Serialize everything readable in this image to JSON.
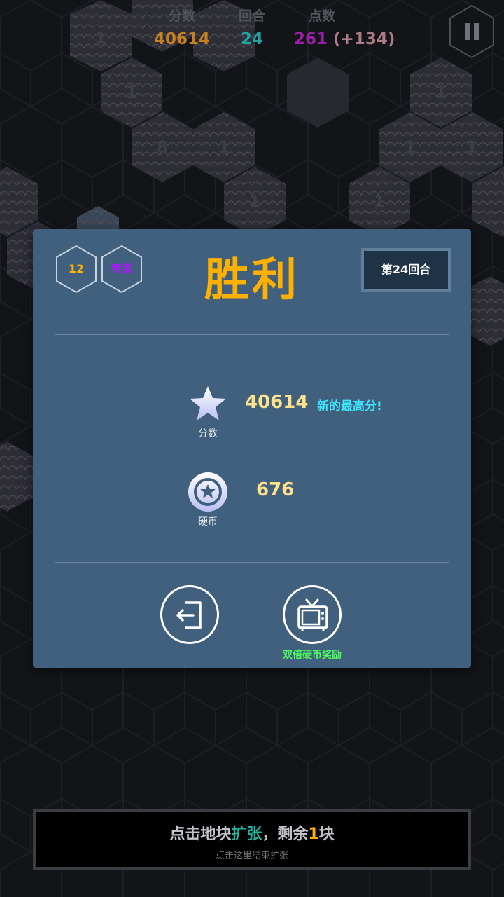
{
  "hud": {
    "score_label": "分数",
    "score_value": "40614",
    "round_label": "回合",
    "round_value": "24",
    "points_label": "点数",
    "points_value": "261",
    "points_bonus": "(+134)",
    "pause_icon": "pause-icon"
  },
  "board": {
    "tile_numbers": [
      "1",
      "1",
      "8",
      "1",
      "1",
      "1",
      "1",
      "1",
      "1"
    ]
  },
  "dialog": {
    "level_badge": "12",
    "difficulty_badge": "专家",
    "title": "胜利",
    "round_badge": "第24回合",
    "score_caption": "分数",
    "score_value": "40614",
    "new_best": "新的最高分!",
    "coins_caption": "硬币",
    "coins_value": "676",
    "exit_icon": "exit-icon",
    "double_coins_icon": "tv-icon",
    "double_coins_label": "双倍硬币奖励"
  },
  "bottom_bar": {
    "main_text_1": "点击地块",
    "main_text_2": "扩张",
    "main_text_3": "，剩余",
    "main_text_4": "1",
    "main_text_5": "块",
    "sub_text": "点击这里结束扩张"
  },
  "colors": {
    "score": "#c8811f",
    "round": "#1fa3a3",
    "points": "#9b1fa8",
    "points_bonus": "#b07a86",
    "title": "#ffb000",
    "dialog_bg": "#40607e",
    "new_best": "#3ee6ff",
    "highlight_green": "#1fb5a0",
    "highlight_yellow": "#ffb000"
  }
}
